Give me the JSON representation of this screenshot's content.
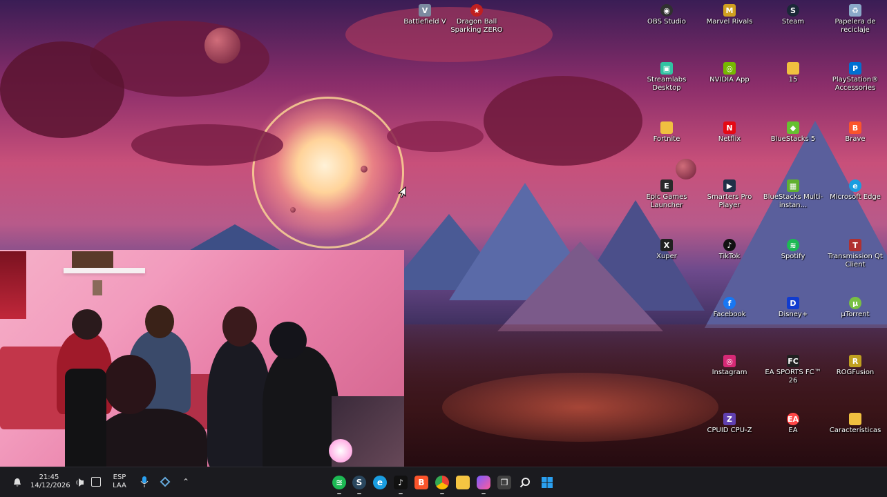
{
  "desktop": {
    "icons": [
      {
        "label": "Battlefield V",
        "icon": "battlefield-icon",
        "color": "#7c8aa0"
      },
      {
        "label": "Dragon Ball Sparking ZERO",
        "icon": "dragon-ball-icon",
        "color": "#c02020"
      },
      {
        "label": "OBS Studio",
        "icon": "obs-icon",
        "color": "#303030"
      },
      {
        "label": "Marvel Rivals",
        "icon": "marvel-rivals-icon",
        "color": "#d0a020"
      },
      {
        "label": "Steam",
        "icon": "steam-icon",
        "color": "#1b2838"
      },
      {
        "label": "Papelera de reciclaje",
        "icon": "recycle-bin-icon",
        "color": "#8aa8c8"
      },
      {
        "label": "Streamlabs Desktop",
        "icon": "streamlabs-icon",
        "color": "#31c3a2"
      },
      {
        "label": "NVIDIA App",
        "icon": "nvidia-icon",
        "color": "#76b900"
      },
      {
        "label": "15",
        "icon": "folder-icon",
        "color": "#f0c040"
      },
      {
        "label": "PlayStation® Accessories",
        "icon": "playstation-icon",
        "color": "#0070d1"
      },
      {
        "label": "Fortnite",
        "icon": "folder-icon",
        "color": "#f0c040"
      },
      {
        "label": "Netflix",
        "icon": "netflix-icon",
        "color": "#e50914"
      },
      {
        "label": "BlueStacks 5",
        "icon": "bluestacks-icon",
        "color": "#66c030"
      },
      {
        "label": "Brave",
        "icon": "brave-icon",
        "color": "#fb542b"
      },
      {
        "label": "Epic Games Launcher",
        "icon": "epic-games-icon",
        "color": "#2a2a2a"
      },
      {
        "label": "Smarters Pro Player",
        "icon": "smarters-icon",
        "color": "#203048"
      },
      {
        "label": "BlueStacks Multi-instan...",
        "icon": "bluestacks-multi-icon",
        "color": "#60b030"
      },
      {
        "label": "Microsoft Edge",
        "icon": "edge-icon",
        "color": "#1a9de0"
      },
      {
        "label": "Xuper",
        "icon": "xuper-icon",
        "color": "#202020"
      },
      {
        "label": "TikTok",
        "icon": "tiktok-icon",
        "color": "#111111"
      },
      {
        "label": "Spotify",
        "icon": "spotify-icon",
        "color": "#1db954"
      },
      {
        "label": "Transmission Qt Client",
        "icon": "transmission-icon",
        "color": "#b03030"
      },
      {
        "label": "Facebook",
        "icon": "facebook-icon",
        "color": "#1877f2"
      },
      {
        "label": "Disney+",
        "icon": "disney-plus-icon",
        "color": "#113ccf"
      },
      {
        "label": "µTorrent",
        "icon": "utorrent-icon",
        "color": "#78c043"
      },
      {
        "label": "Instagram",
        "icon": "instagram-icon",
        "color": "#d62976"
      },
      {
        "label": "EA SPORTS FC™ 26",
        "icon": "ea-fc-icon",
        "color": "#202020"
      },
      {
        "label": "ROGFusion",
        "icon": "rog-icon",
        "color": "#c0a020"
      },
      {
        "label": "CPUID CPU-Z",
        "icon": "cpuz-icon",
        "color": "#6040b0"
      },
      {
        "label": "EA",
        "icon": "ea-icon",
        "color": "#ff4747"
      },
      {
        "label": "Características",
        "icon": "folder-icon",
        "color": "#f0c040"
      }
    ]
  },
  "taskbar": {
    "time": "21:45",
    "date": "14/12/2026",
    "language": "ESP",
    "keyboard": "LAA",
    "start_icon": "windows-start-icon",
    "search_icon": "search-icon",
    "taskview_icon": "task-view-icon",
    "pinned": [
      {
        "icon": "spotify-icon",
        "color": "#1db954"
      },
      {
        "icon": "steam-icon",
        "color": "#2a475e"
      },
      {
        "icon": "edge-icon",
        "color": "#1a9de0"
      },
      {
        "icon": "tiktok-icon",
        "color": "#111111"
      },
      {
        "icon": "brave-icon",
        "color": "#fb542b"
      },
      {
        "icon": "chrome-icon",
        "color": "#34a853"
      },
      {
        "icon": "file-explorer-icon",
        "color": "#f5c542"
      },
      {
        "icon": "copilot-icon",
        "color": "#7a5cff"
      },
      {
        "icon": "task-view-icon",
        "color": "#404040"
      },
      {
        "icon": "search-icon",
        "color": "#2b2b2b"
      },
      {
        "icon": "windows-start-icon",
        "color": "#2aa0f0"
      }
    ]
  }
}
